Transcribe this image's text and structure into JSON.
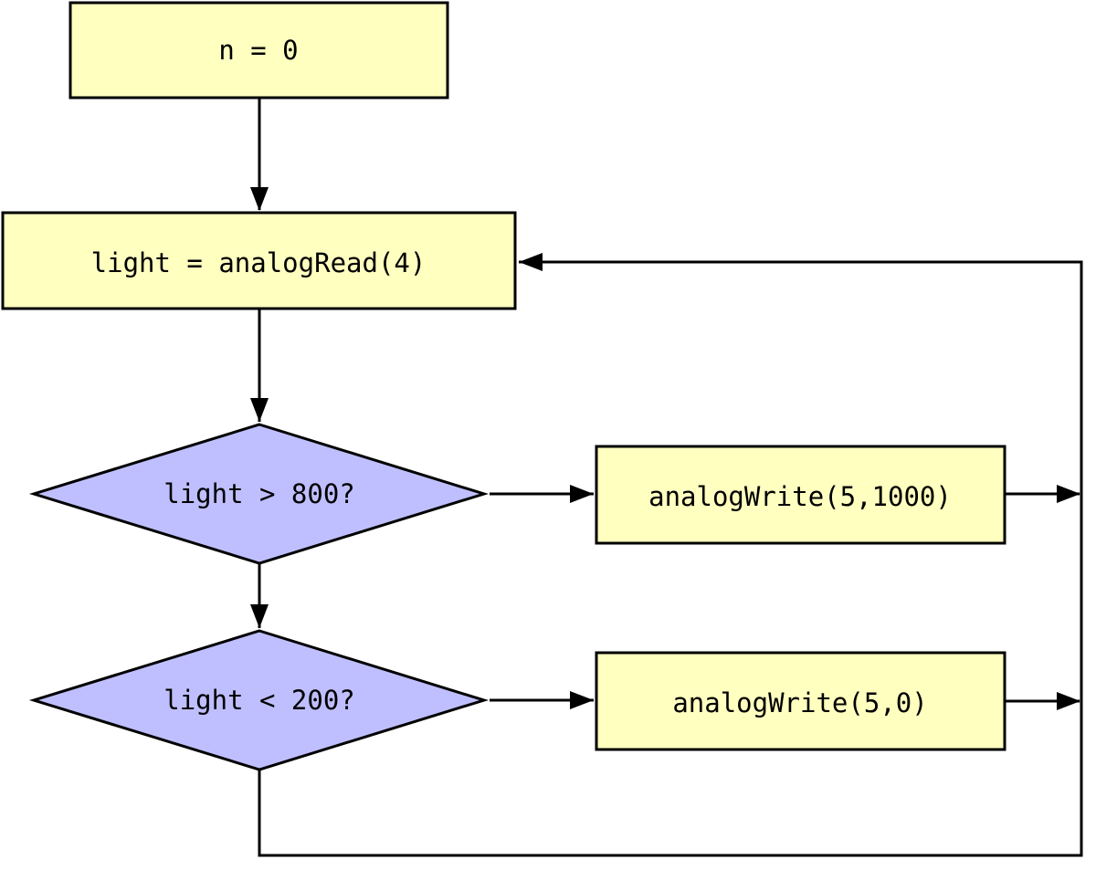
{
  "colors": {
    "process": "#ffffc0",
    "decision": "#bfbfff",
    "line": "#000000"
  },
  "nodes": {
    "init": "n = 0",
    "read": "light = analogRead(4)",
    "check_high": "light > 800?",
    "check_low": "light < 200?",
    "write_high": "analogWrite(5,1000)",
    "write_low": "analogWrite(5,0)"
  },
  "edges": [
    {
      "from": "init",
      "to": "read"
    },
    {
      "from": "read",
      "to": "check_high"
    },
    {
      "from": "check_high",
      "to": "write_high"
    },
    {
      "from": "check_high",
      "to": "check_low"
    },
    {
      "from": "check_low",
      "to": "write_low"
    },
    {
      "from": "write_high",
      "to": "read"
    },
    {
      "from": "write_low",
      "to": "read"
    },
    {
      "from": "check_low",
      "to": "read"
    }
  ]
}
